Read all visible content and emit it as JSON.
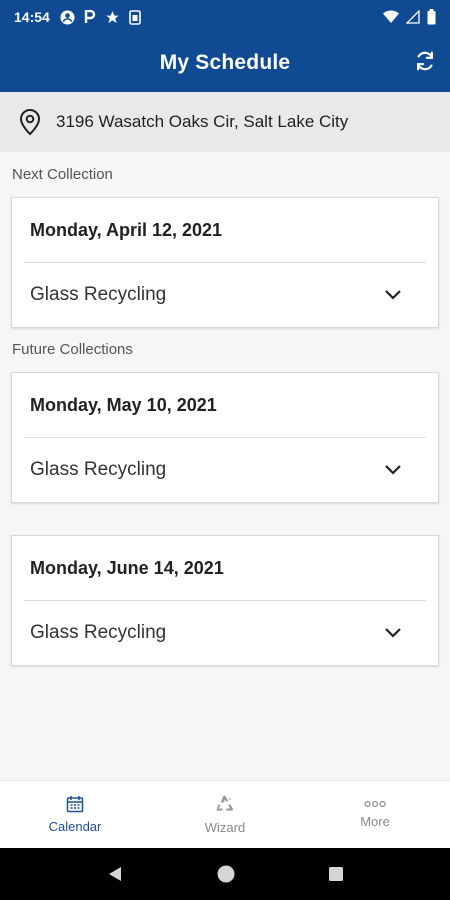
{
  "status_bar": {
    "time": "14:54",
    "icons": [
      "account-circle-icon",
      "parking-icon",
      "star-icon",
      "sim-icon"
    ],
    "right_icons": [
      "wifi-icon",
      "signal-icon",
      "battery-icon"
    ]
  },
  "app_bar": {
    "title": "My Schedule",
    "refresh_icon": "refresh-icon"
  },
  "address": {
    "icon": "location-pin-icon",
    "text": "3196 Wasatch Oaks Cir, Salt Lake City"
  },
  "next_collection": {
    "label": "Next Collection",
    "date": "Monday, April 12, 2021",
    "items": [
      {
        "label": "Glass Recycling"
      }
    ]
  },
  "future_collections": {
    "label": "Future Collections",
    "cards": [
      {
        "date": "Monday, May 10, 2021",
        "items": [
          {
            "label": "Glass Recycling"
          }
        ]
      },
      {
        "date": "Monday, June 14, 2021",
        "items": [
          {
            "label": "Glass Recycling"
          }
        ]
      }
    ]
  },
  "bottom_nav": {
    "tabs": [
      {
        "label": "Calendar",
        "icon": "calendar-icon",
        "active": true
      },
      {
        "label": "Wizard",
        "icon": "recycle-icon",
        "active": false
      },
      {
        "label": "More",
        "icon": "more-dots-icon",
        "active": false
      }
    ]
  },
  "colors": {
    "primary": "#0f4a93",
    "active_tab": "#1f4f95",
    "inactive_tab": "#8a8a8a"
  }
}
